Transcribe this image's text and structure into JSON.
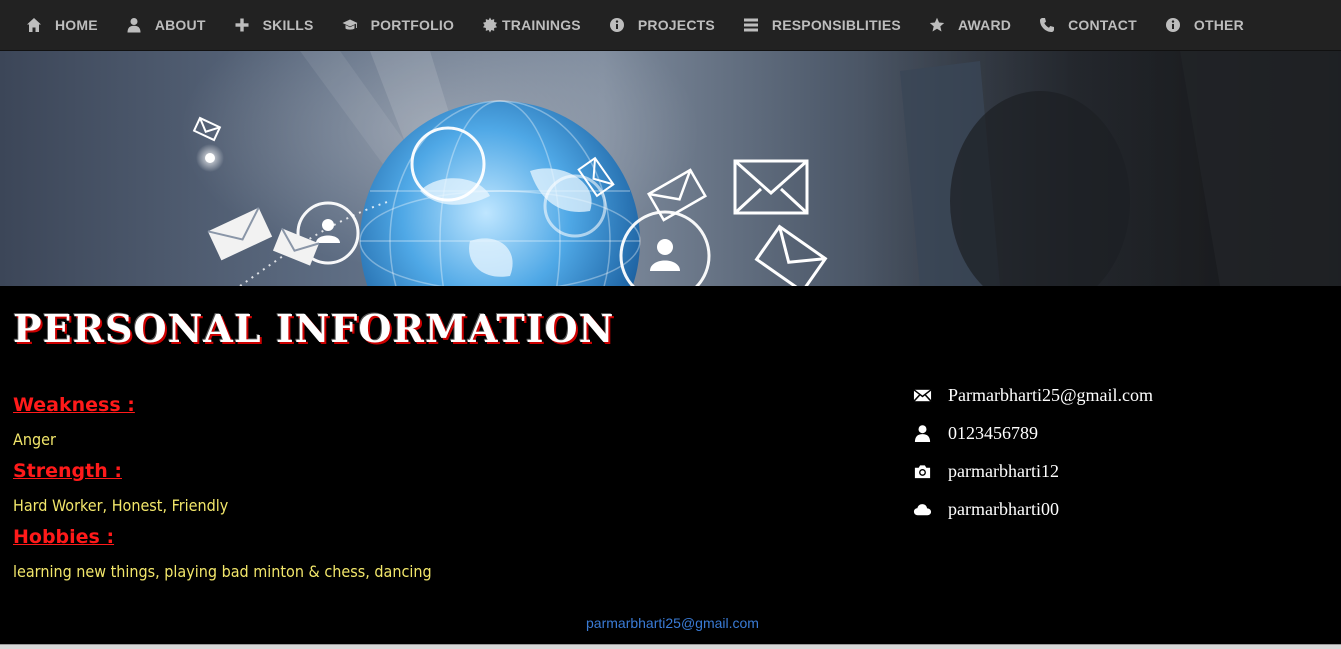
{
  "nav": {
    "items": [
      {
        "label": "HOME",
        "icon": "home-icon"
      },
      {
        "label": "ABOUT",
        "icon": "user-icon"
      },
      {
        "label": "SKILLS",
        "icon": "plus-icon"
      },
      {
        "label": "PORTFOLIO",
        "icon": "graduation-cap-icon"
      },
      {
        "label": "TRAININGS",
        "icon": "certificate-icon"
      },
      {
        "label": "PROJECTS",
        "icon": "info-icon"
      },
      {
        "label": "RESPONSIBLITIES",
        "icon": "list-icon"
      },
      {
        "label": "AWARD",
        "icon": "star-icon"
      },
      {
        "label": "CONTACT",
        "icon": "phone-icon"
      },
      {
        "label": "OTHER",
        "icon": "info-icon"
      }
    ]
  },
  "main": {
    "title": "PERSONAL INFORMATION",
    "weakness_label": "Weakness :",
    "weakness_value": "Anger",
    "strength_label": "Strength :",
    "strength_value": "Hard Worker, Honest, Friendly",
    "hobbies_label": "Hobbies :",
    "hobbies_value": "learning new things, playing bad minton & chess, dancing"
  },
  "contact": {
    "items": [
      {
        "icon": "envelope-icon",
        "value": "Parmarbharti25@gmail.com"
      },
      {
        "icon": "user-icon",
        "value": "0123456789"
      },
      {
        "icon": "camera-icon",
        "value": "parmarbharti12"
      },
      {
        "icon": "cloud-icon",
        "value": "parmarbharti00"
      }
    ]
  },
  "footer": {
    "email": "parmarbharti25@gmail.com"
  },
  "colors": {
    "nav_bg": "#222222",
    "nav_text": "#bdbdbd",
    "label_red": "#ff1a1a",
    "value_yellow": "#f2e66a",
    "link_blue": "#3a7bd5"
  }
}
